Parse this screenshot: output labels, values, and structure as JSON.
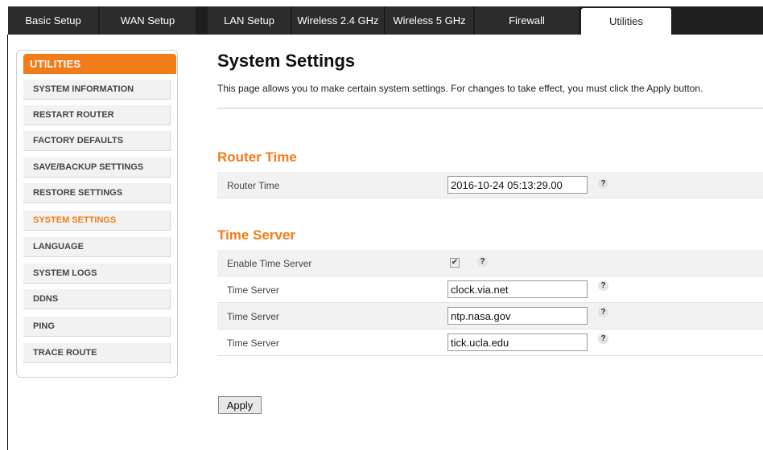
{
  "tabs": [
    {
      "label": "Basic Setup"
    },
    {
      "label": "WAN Setup"
    },
    {
      "label": "LAN Setup"
    },
    {
      "label": "Wireless 2.4 GHz"
    },
    {
      "label": "Wireless 5 GHz"
    },
    {
      "label": "Firewall"
    },
    {
      "label": "Utilities",
      "active": true
    }
  ],
  "sidebar": {
    "header": "UTILITIES",
    "items": [
      {
        "label": "SYSTEM INFORMATION"
      },
      {
        "label": "RESTART ROUTER"
      },
      {
        "label": "FACTORY DEFAULTS"
      },
      {
        "label": "SAVE/BACKUP SETTINGS"
      },
      {
        "label": "RESTORE SETTINGS"
      },
      {
        "label": "SYSTEM SETTINGS",
        "active": true
      },
      {
        "label": "LANGUAGE"
      },
      {
        "label": "SYSTEM LOGS"
      },
      {
        "label": "DDNS"
      },
      {
        "label": "PING"
      },
      {
        "label": "TRACE ROUTE"
      }
    ]
  },
  "main": {
    "title": "System Settings",
    "description": "This page allows you to make certain system settings. For changes to take effect, you must click the Apply button.",
    "router_time": {
      "heading": "Router Time",
      "label": "Router Time",
      "value": "2016-10-24 05:13:29.00"
    },
    "time_server": {
      "heading": "Time Server",
      "enable_label": "Enable Time Server",
      "enabled": true,
      "checkmark": "✔",
      "servers": [
        {
          "label": "Time Server",
          "value": "clock.via.net"
        },
        {
          "label": "Time Server",
          "value": "ntp.nasa.gov"
        },
        {
          "label": "Time Server",
          "value": "tick.ucla.edu"
        }
      ]
    },
    "help_glyph": "?",
    "apply_label": "Apply"
  },
  "colors": {
    "accent": "#f07d1a",
    "tabbar": "#1e1e1e"
  }
}
